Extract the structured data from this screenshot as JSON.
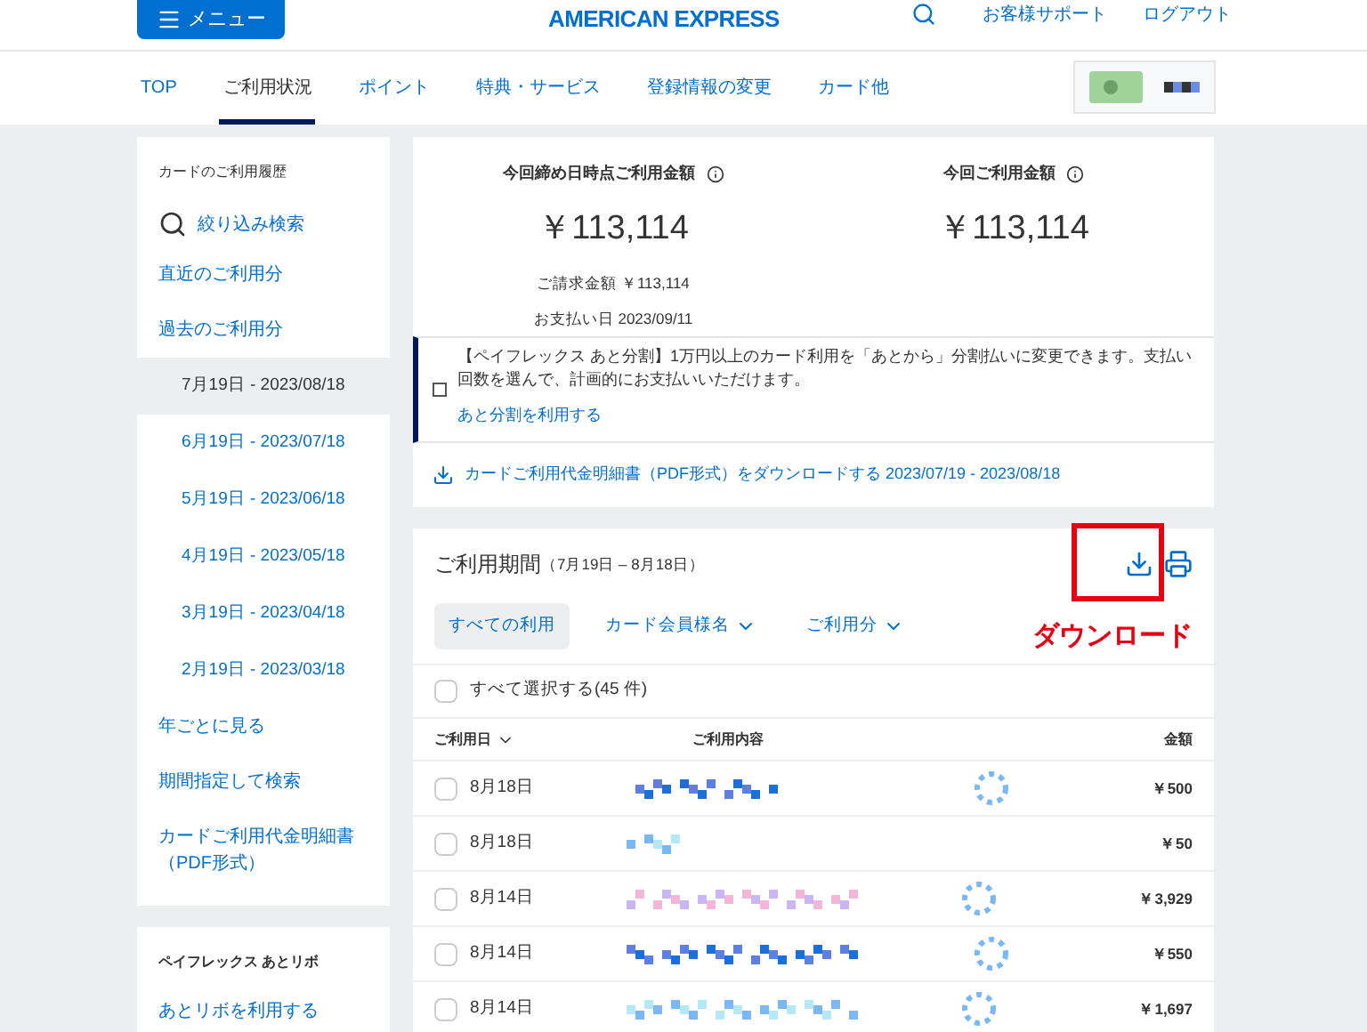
{
  "header": {
    "menu_label": "メニュー",
    "logo": "AMERICAN EXPRESS",
    "links": [
      "お客様サポート",
      "ログアウト"
    ]
  },
  "nav": {
    "tabs": [
      {
        "label": "TOP",
        "selected": false
      },
      {
        "label": "ご利用状況",
        "selected": true
      },
      {
        "label": "ポイント",
        "selected": false
      },
      {
        "label": "特典・サービス",
        "selected": false
      },
      {
        "label": "登録情報の変更",
        "selected": false
      },
      {
        "label": "カード他",
        "selected": false
      }
    ]
  },
  "sidebar": {
    "title": "カードのご利用履歴",
    "search": "絞り込み検索",
    "items": [
      {
        "label": "直近のご利用分",
        "selected": false
      },
      {
        "label": "過去のご利用分",
        "selected": false,
        "children": [
          {
            "label": "7月19日 - 2023/08/18",
            "selected": true
          },
          {
            "label": "6月19日 - 2023/07/18",
            "selected": false
          },
          {
            "label": "5月19日 - 2023/06/18",
            "selected": false
          },
          {
            "label": "4月19日 - 2023/05/18",
            "selected": false
          },
          {
            "label": "3月19日 - 2023/04/18",
            "selected": false
          },
          {
            "label": "2月19日 - 2023/03/18",
            "selected": false
          }
        ]
      },
      {
        "label": "年ごとに見る",
        "selected": false
      },
      {
        "label": "期間指定して検索",
        "selected": false
      },
      {
        "label": "カードご利用代金明細書（PDF形式）",
        "selected": false
      }
    ],
    "section2_title": "ペイフレックス あとリボ",
    "section2_items": [
      "あとリボを利用する"
    ]
  },
  "summary": {
    "columns": [
      {
        "heading": "今回締め日時点ご利用金額",
        "amount": "￥113,114",
        "details": [
          "ご請求金額 ￥113,114",
          "お支払い日 2023/09/11"
        ]
      },
      {
        "heading": "今回ご利用金額",
        "amount": "￥113,114"
      }
    ],
    "notice": {
      "text": "【ペイフレックス あと分割】1万円以上のカード利用を「あとから」分割払いに変更できます。支払い回数を選んで、計画的にお支払いいただけます。",
      "link": "あと分割を利用する"
    },
    "download_link": "カードご利用代金明細書（PDF形式）をダウンロードする 2023/07/19 - 2023/08/18"
  },
  "transactions": {
    "title": "ご利用期間",
    "period": "（7月19日 – 8月18日）",
    "filters": [
      {
        "label": "すべての利用",
        "selected": true,
        "kind": "button"
      },
      {
        "label": "カード会員様名",
        "selected": false,
        "kind": "dropdown"
      },
      {
        "label": "ご利用分",
        "selected": false,
        "kind": "dropdown"
      }
    ],
    "select_all": {
      "label": "すべて選択する(45 件)",
      "checked": false
    },
    "columns": [
      "ご利用日",
      "ご利用内容",
      "金額"
    ],
    "rows": [
      {
        "date": "8月18日",
        "amount": "￥500",
        "checked": false
      },
      {
        "date": "8月18日",
        "amount": "￥50",
        "checked": false
      },
      {
        "date": "8月14日",
        "amount": "￥3,929",
        "checked": false
      },
      {
        "date": "8月14日",
        "amount": "￥550",
        "checked": false
      },
      {
        "date": "8月14日",
        "amount": "￥1,697",
        "checked": false
      }
    ]
  },
  "annotation": {
    "label": "ダウンロード"
  }
}
